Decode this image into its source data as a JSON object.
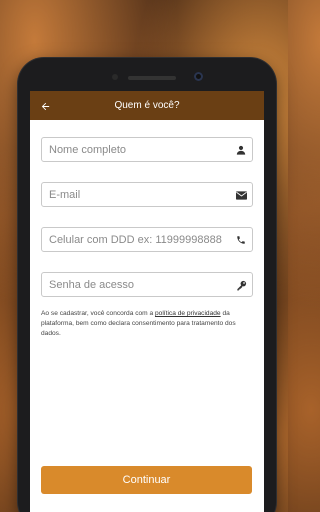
{
  "header": {
    "title": "Quem é você?",
    "back_icon": "arrow-left-icon"
  },
  "form": {
    "fields": [
      {
        "placeholder": "Nome completo",
        "value": "",
        "icon": "user-icon"
      },
      {
        "placeholder": "E-mail",
        "value": "",
        "icon": "envelope-icon"
      },
      {
        "placeholder": "Celular com DDD ex: 11999998888",
        "value": "",
        "icon": "phone-icon"
      },
      {
        "placeholder": "Senha de acesso",
        "value": "",
        "icon": "key-icon"
      }
    ],
    "terms": {
      "before": "Ao se cadastrar, você concorda com a ",
      "link": "política de privacidade",
      "after": " da plataforma, bem como declara consentimento para tratamento dos dados."
    },
    "continue_label": "Continuar"
  },
  "colors": {
    "appbar": "#6a3f14",
    "accent": "#d98a2b"
  }
}
